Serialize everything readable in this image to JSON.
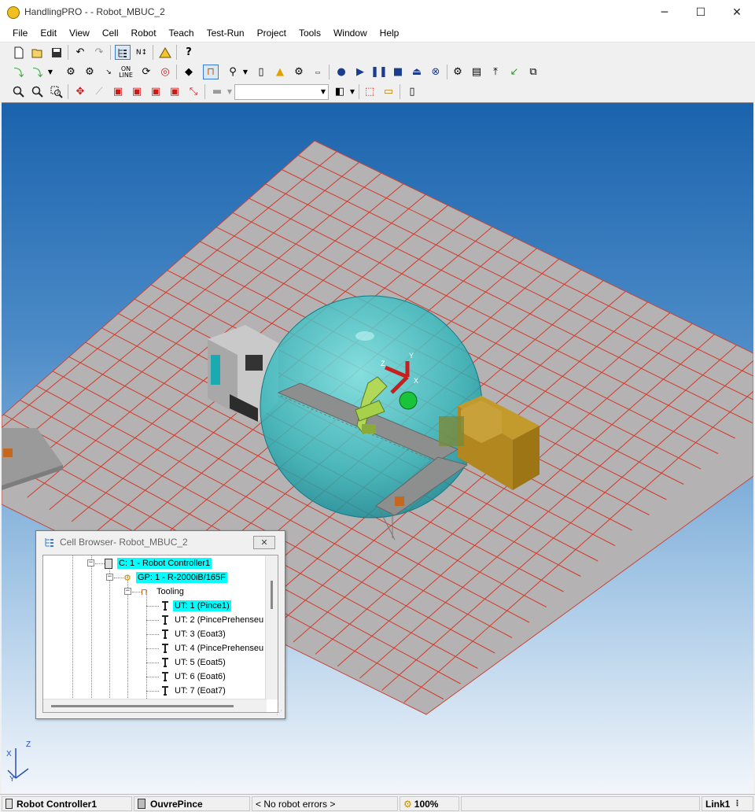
{
  "window": {
    "title": "HandlingPRO -  - Robot_MBUC_2",
    "minimize": "─",
    "maximize": "☐",
    "close": "✕"
  },
  "menu": [
    "File",
    "Edit",
    "View",
    "Cell",
    "Robot",
    "Teach",
    "Test-Run",
    "Project",
    "Tools",
    "Window",
    "Help"
  ],
  "toolbar": {
    "online_label_1": "ON",
    "online_label_2": "LINE",
    "dropdown_value": ""
  },
  "viewport": {
    "axis_x": "X",
    "axis_y": "Y",
    "axis_z": "Z",
    "frame_x": "X",
    "frame_y": "Y",
    "frame_z": "Z"
  },
  "cell_browser": {
    "title": "Cell Browser- Robot_MBUC_2",
    "close": "✕",
    "rows": [
      {
        "label": "C: 1 - Robot Controller1",
        "selected": true
      },
      {
        "label": "GP: 1 - R-2000iB/165F",
        "selected": true
      },
      {
        "label": "Tooling",
        "selected": false
      },
      {
        "label": "UT: 1  (Pince1)",
        "selected": true
      },
      {
        "label": "UT: 2  (PincePrehenseu",
        "selected": false
      },
      {
        "label": "UT: 3  (Eoat3)",
        "selected": false
      },
      {
        "label": "UT: 4  (PincePrehenseu",
        "selected": false
      },
      {
        "label": "UT: 5  (Eoat5)",
        "selected": false
      },
      {
        "label": "UT: 6  (Eoat6)",
        "selected": false
      },
      {
        "label": "UT: 7  (Eoat7)",
        "selected": false
      }
    ]
  },
  "status": {
    "controller": "Robot Controller1",
    "program": "OuvrePince",
    "errors": "< No robot errors >",
    "speed": "100%",
    "link": "Link1"
  },
  "colors": {
    "floor": "#b4b2b2",
    "grid": "#d23a2a",
    "sphere": "#39c4c6",
    "selection": "#00ffff"
  }
}
